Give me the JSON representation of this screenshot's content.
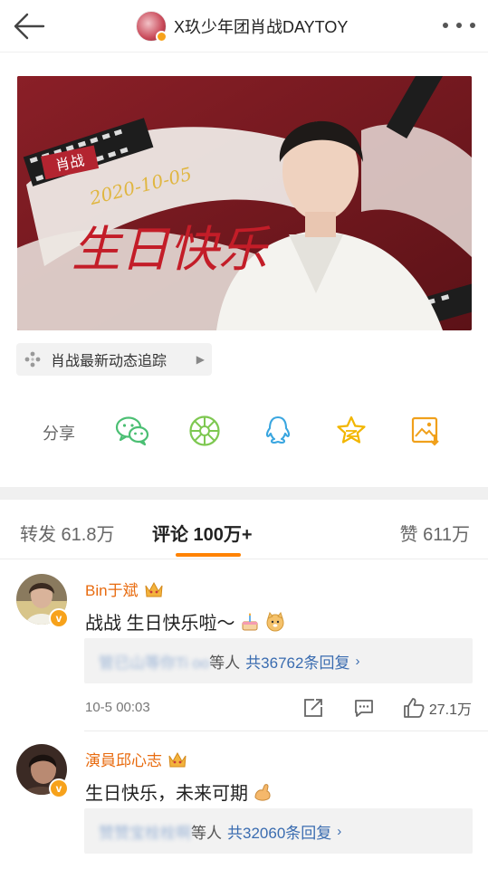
{
  "header": {
    "title": "X玖少年团肖战DAYTOY"
  },
  "banner": {
    "tag_text": "肖战",
    "signature_date": "2020-10-05",
    "signature_text": "生日快乐"
  },
  "topic": {
    "label": "肖战最新动态追踪"
  },
  "share": {
    "label": "分享",
    "icons": [
      "wechat-icon",
      "moments-icon",
      "qq-icon",
      "qzone-icon",
      "save-image-icon"
    ]
  },
  "tabs": [
    {
      "label": "转发 61.8万",
      "active": false
    },
    {
      "label": "评论 100万+",
      "active": true
    },
    {
      "label": "赞 611万",
      "active": false
    }
  ],
  "colors": {
    "accent": "#ff8200",
    "name": "#e86b0f",
    "link": "#3a6cb0"
  },
  "comments": [
    {
      "name": "Bin于斌",
      "text": "战战 生日快乐啦～",
      "emoji": [
        "cake-emoji",
        "doge-emoji"
      ],
      "reply_users": "管已山等你Ti oo",
      "reply_suffix": "等人",
      "reply_count": "共36762条回复",
      "time": "10-5 00:03",
      "likes": "27.1万"
    },
    {
      "name": "演員邱心志",
      "text": "生日快乐，未来可期",
      "emoji": [
        "muscle-emoji"
      ],
      "reply_users": "赞赞宝栓栓啊",
      "reply_suffix": "等人",
      "reply_count": "共32060条回复"
    }
  ]
}
